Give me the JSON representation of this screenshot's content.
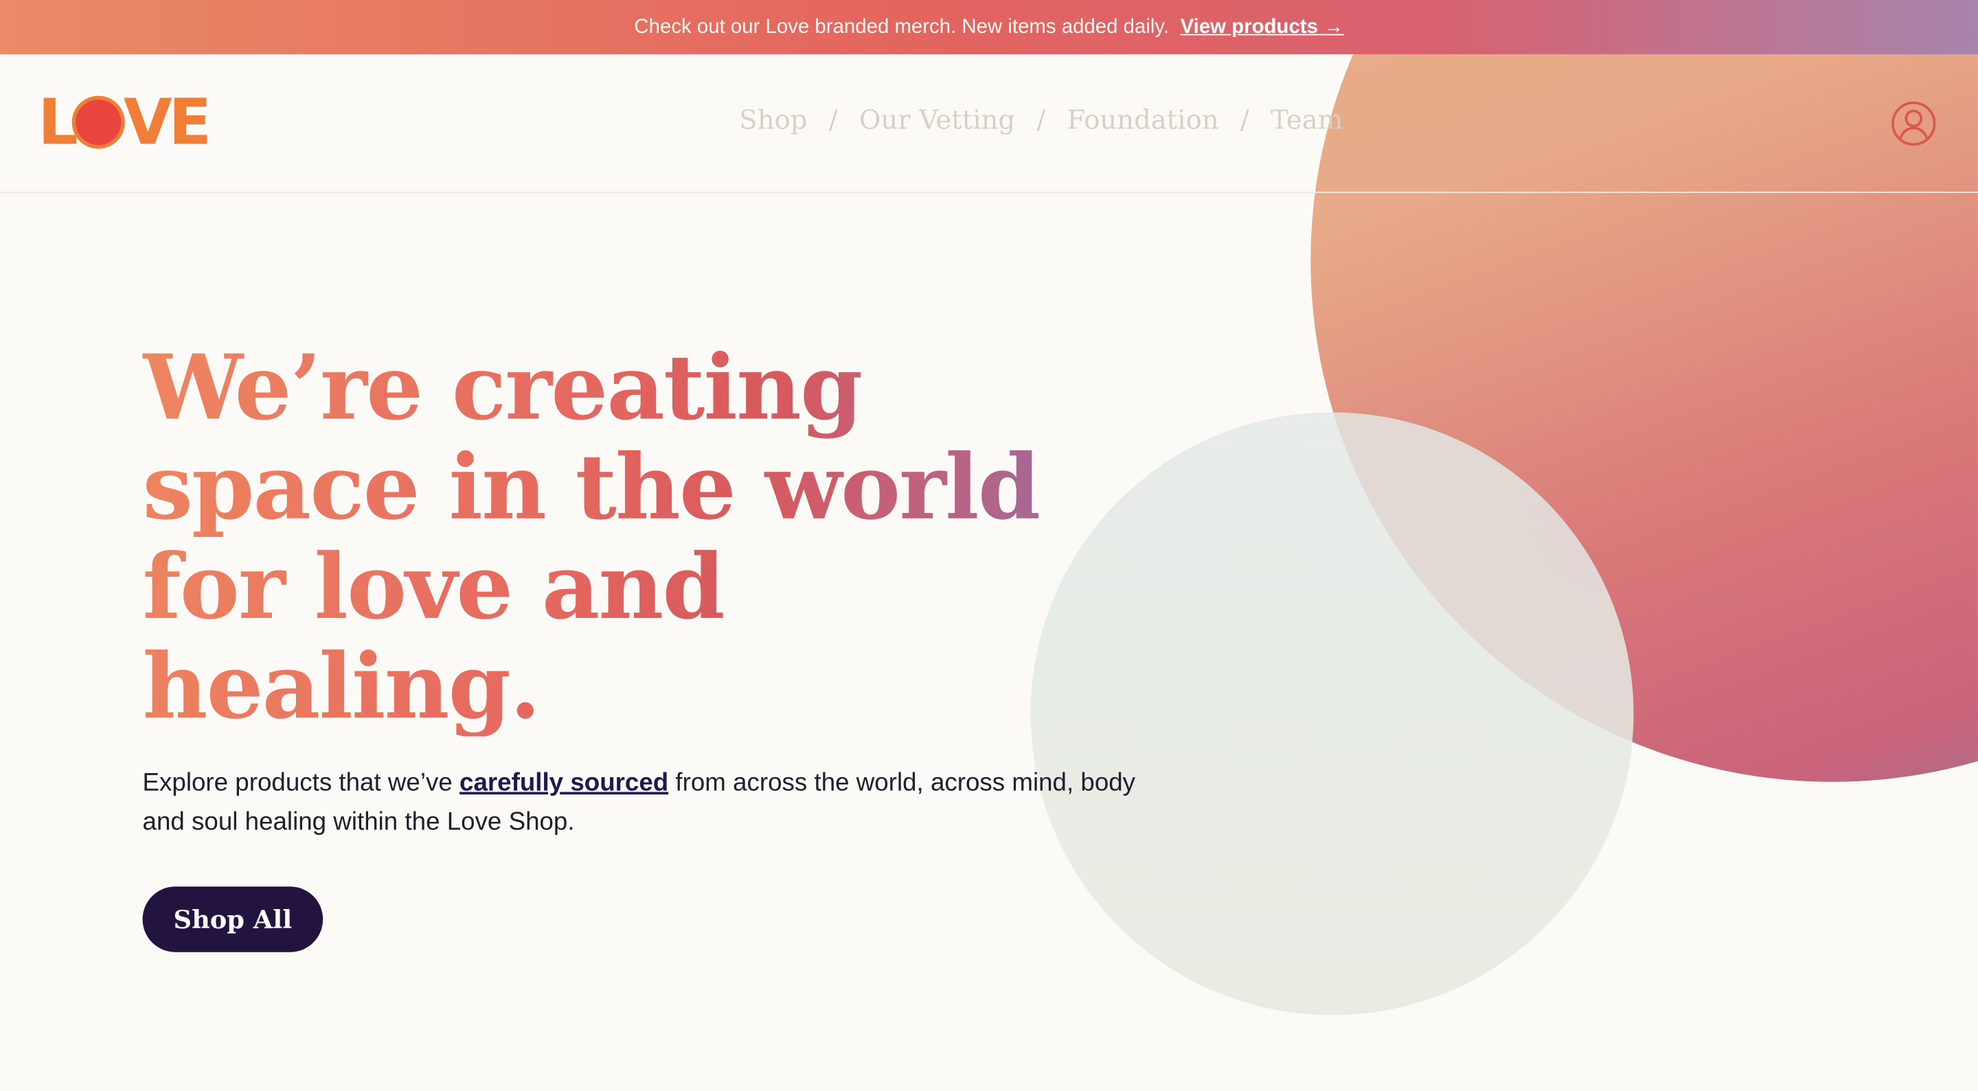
{
  "announcement": {
    "text": "Check out our Love branded merch. New items added daily.",
    "link_label": "View products →"
  },
  "header": {
    "logo_text_left": "L",
    "logo_text_right": "VE",
    "nav": [
      {
        "label": "Shop"
      },
      {
        "label": "Our Vetting"
      },
      {
        "label": "Foundation"
      },
      {
        "label": "Team"
      }
    ],
    "nav_separator": "/",
    "account_icon": "user-circle-icon"
  },
  "hero": {
    "title_lines": [
      "We’re creating",
      "space in the world",
      "for love and",
      "healing."
    ],
    "desc_before": "Explore products that we’ve ",
    "desc_link": "carefully sourced",
    "desc_after": " from across the world, across mind, body and soul healing within the Love Shop.",
    "cta_label": "Shop All"
  },
  "colors": {
    "background": "#fbfaf6",
    "logo": "#f07e36",
    "logo_dot": "#e8453f",
    "nav_text": "#d9d0c4",
    "cta_background": "#23143f",
    "link": "#1c1a4e"
  }
}
